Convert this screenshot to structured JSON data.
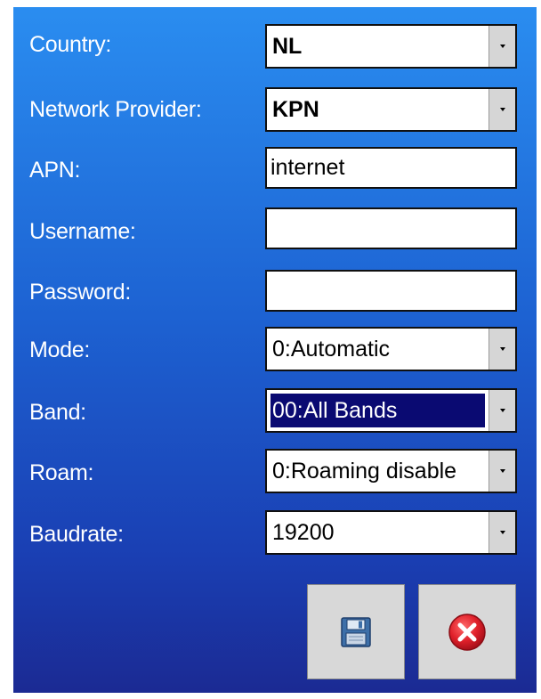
{
  "form": {
    "country": {
      "label": "Country:",
      "value": "NL"
    },
    "network_provider": {
      "label": "Network Provider:",
      "value": "KPN"
    },
    "apn": {
      "label": "APN:",
      "value": "internet"
    },
    "username": {
      "label": "Username:",
      "value": ""
    },
    "password": {
      "label": "Password:",
      "value": ""
    },
    "mode": {
      "label": "Mode:",
      "value": "0:Automatic"
    },
    "band": {
      "label": "Band:",
      "value": "00:All Bands"
    },
    "roam": {
      "label": "Roam:",
      "value": "0:Roaming disable"
    },
    "baudrate": {
      "label": "Baudrate:",
      "value": "19200"
    }
  },
  "buttons": {
    "save_icon": "floppy-disk-icon",
    "cancel_icon": "red-x-circle-icon"
  },
  "colors": {
    "panel_top": "#2a8df0",
    "panel_bottom": "#1b2a93",
    "selection": "#0a0a72",
    "cancel_red": "#e0202a"
  }
}
